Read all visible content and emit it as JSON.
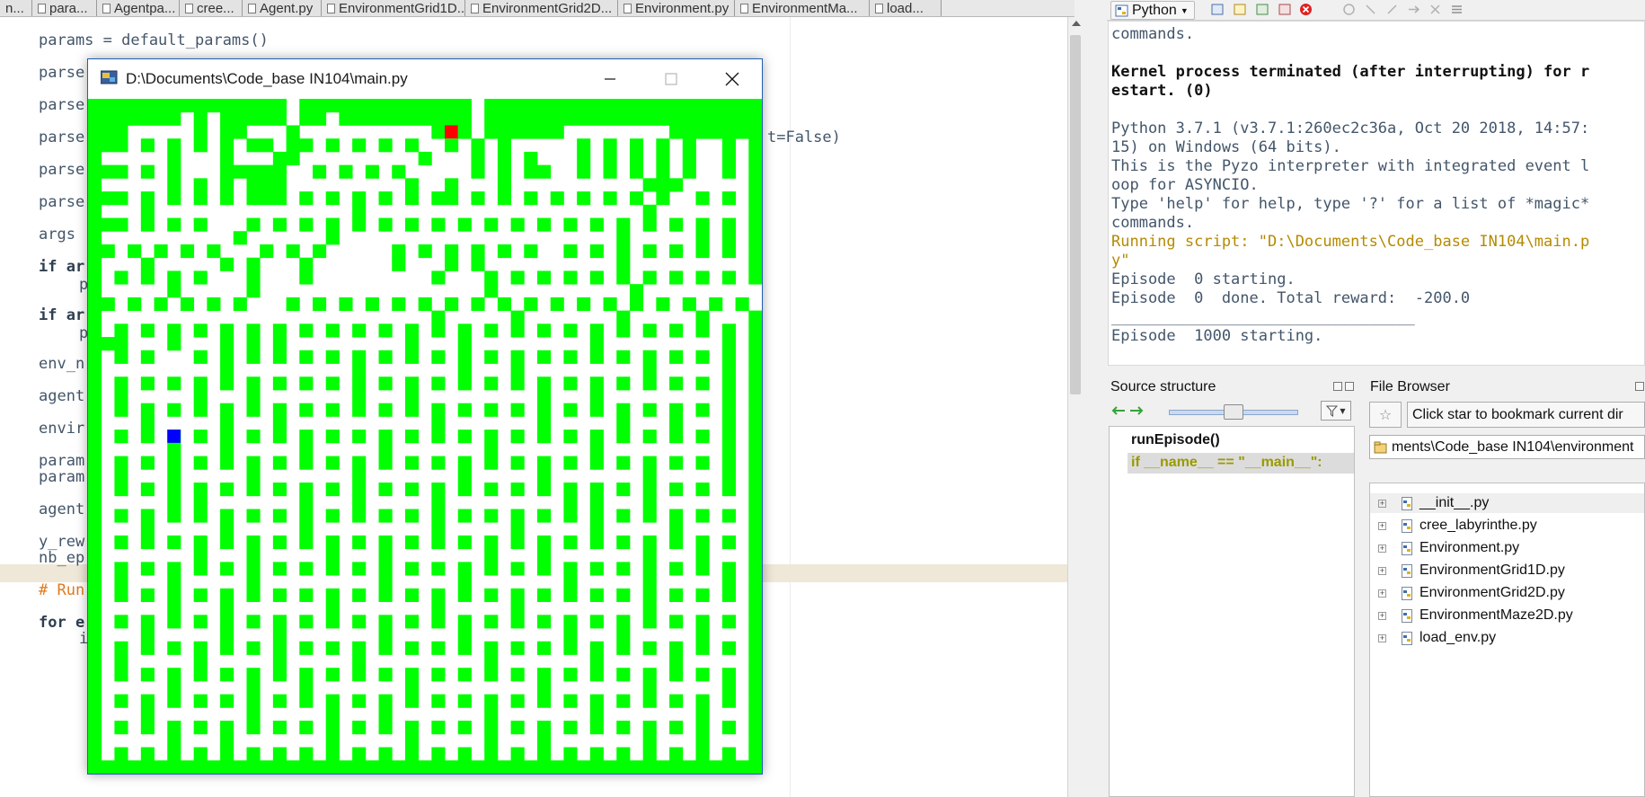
{
  "editor_tabs": [
    {
      "label": "n..."
    },
    {
      "label": "para..."
    },
    {
      "label": "Agentpa..."
    },
    {
      "label": "cree..."
    },
    {
      "label": "Agent.py"
    },
    {
      "label": "EnvironmentGrid1D..."
    },
    {
      "label": "EnvironmentGrid2D..."
    },
    {
      "label": "Environment.py"
    },
    {
      "label": "EnvironmentMa..."
    },
    {
      "label": "load..."
    }
  ],
  "editor_lines": [
    "params = default_params()",
    "parse",
    "parse",
    "parse",
    "parse",
    "parse",
    "args",
    "if ar",
    "p",
    "if ar",
    "p",
    "env_n",
    "agent",
    "envir",
    "param",
    "param",
    "agent",
    "y_rew",
    "nb_ep",
    "# Run",
    "for e",
    "i",
    "t=False)"
  ],
  "maze_window": {
    "title": "D:\\Documents\\Code_base IN104\\main.py",
    "minimize_label": "Minimize",
    "maximize_label": "Maximize",
    "close_label": "Close"
  },
  "maze": {
    "colors": {
      "wall": "#00ff00",
      "path": "#ffffff",
      "goal": "#ff0000",
      "agent": "#0000ff"
    },
    "goal_cell": [
      2,
      27
    ],
    "agent_cell": [
      25,
      6
    ],
    "rows": [
      "WWWWWWWWWWWWWWW.WWWWWWWWWWWWW.WWWWWWWWWWWWWWWWWWWWW",
      "WWWWWWW.W.WWWWW.WW.WWWWWWWWWW.WWWWWWWWWWWWWWWWWWWWW",
      "WWW.....W.WW...W.........GW.W.WWWWWW........WWWWWWW",
      "WWW.W.W.W.W.WW.WW.W.W.W.W..W.W.W.....W.W.W.W.W..W.W",
      "W.....W...W...WW.........W...W.W.W...W.W.W.W.W..W.W",
      "WWW.W.W...WWWWW..W.W.W.W.....W.W.WW..W.W.W.W.W..W.W",
      "W.....W.W.W.WWW.........W..W...W..........WWW.....W",
      "WWW.W.W.W.W.WWW.W.W.W.W.W.WW.W.W.W.W.W.W.W.W..W.W.W",
      "W...W...............W.....................W.......W",
      "WWW.W.W.W...W.W.W.W.W.W.W.W.W.W.W.W.W.W.W.W.W.W.W.W",
      "W..........W......W.....................W.....W.W.W",
      "WW.W.W.W.W...W.W.W.....W.W.W.W.W.W..W.W.W.W.W.W.W.W",
      "W...W.....W.W...W......W...W.W..........W.........W",
      "W.W.W.W.W...W...W.........W...W.W.W.W.W.W.W.W.W.W.W",
      "W.....W.....W.................W..........W.........W",
      "WW.W.W.W.W.W...W.W.W.W.W.W.W.W.W.W.W.W.W.W.W.W.W.W.W",
      "W.........................W.....W.......W.....W...W",
      "W.W.W.W.W.W.W.W.W.W.W.W.W.W.W.W.W.W.W.W.W.W.W.W.W.W",
      "WWW...W...W.W.W.........W...W.........W.........W.W",
      "W.W.W...W.W.W.W.W.W.W.W.W.W.W.W.W.W.W.W.W.W.W.W.W.W",
      "W.........W.........W.......W...W.........W.....W.W",
      "W.W.W.W.W.W.W.W.W.W.W.W.W.W.W.W.W.W.W.W.W.W.W.W.W.W",
      "W.W.....W...W.......W...W.........W...W.........W.W",
      "W.W.W.W.W.W.W.W.W.W.W.W.W.W.W.W.W.W.W.W.W.W.W.W.W.W",
      "W...W.....W...W...........W.......W.....W...W...W.W",
      "W.W.W.W.W.W.W.W.W.W.W.W.W.W.W.W.W.W.W.W.W.W.W.W.W.W",
      "W.....W...W.....W.....W.......W.......W.........W.W",
      "W.W.W.W.W.W.W.W.W.W.W.W.W.W.W.W.W.W.W.W.W.W.W.W.W.W",
      "W.W...W.....W.......W.......W.....W.......W.....W.W",
      "W.W.W.W.W.W.W.W.W.W.W.W.W.W.W.W.W.W.W.W.W.W.W.W.W.W",
      "W.....W.W.......W...W.....W.........W.W...W.......W",
      "W.W.W.W.W.W.W.W.W.W.W.W.W.W.W.W.W.W.W.W.W.W.W.W.W.W",
      "W...W.....W.....W.........W.....W.....W.....W.....W",
      "W.W.W.W.W.W.W.W.W.W.W.W.W.W.W.W.W.W.W.W.W.W.W.W.W.W",
      "W.......W...W.....W...W.......W...W.......W...W...W",
      "W.W.W.W.W.W.W.W.W.W.W.W.W.W.W.W.W.W.W.W.W.W.W.W.W.W",
      "W.W...W.....W.........W.....W.......W.....W.....W.W",
      "W.W.W.W.W.W.W.W.W.W.W.W.W.W.W.W.W.W.W.W.W.W.W.W.W.W",
      "W.....W...W.......W.......W.....W.........W.......W",
      "W.W.W.W.W.W.W.W.W.W.W.W.W.W.W.W.W.W.W.W.W.W.W.W.W.W",
      "W...W.....W...W.......W.....W.......W...W.....W...W",
      "W.W.W.W.W.W.W.W.W.W.W.W.W.W.W.W.W.W.W.W.W.W.W.W.W.W",
      "W.W.....W.....W.....W.........W.......W.....W.....W",
      "W.W.W.W.W.W.W.W.W.W.W.W.W.W.W.W.W.W.W.W.W.W.W.W.W.W",
      "W.....W.....W...W.......W.........W.......W.....W.W",
      "W.W.W.W.W.W.W.W.W.W.W.W.W.W.W.W.W.W.W.W.W.W.W.W.W.W",
      "W...W.......W.....W...W.......W.......W.......W...W",
      "W.W.W.W.W.W.W.W.W.W.W.W.W.W.W.W.W.W.W.W.W.W.W.W.W.W",
      "W.....W...W.......W.....W.....W...W.......W...W...W",
      "W.W.W.W.W.W.W.W.W.W.W.W.W.W.W.W.W.W.W.W.W.W.W.W.W.W",
      "WWWWWWWWWWWWWWWWWWWWWWWWWWWWWWWWWWWWWWWWWWWWWWWWWWW"
    ]
  },
  "shell_toolbar": {
    "kernel_label": "Python"
  },
  "shell_lines": [
    {
      "text": "commands.",
      "style": "std"
    },
    {
      "text": "",
      "style": "std"
    },
    {
      "text": "Kernel process terminated (after interrupting) for r",
      "style": "bold"
    },
    {
      "text": "estart. (0)",
      "style": "bold"
    },
    {
      "text": "",
      "style": "std"
    },
    {
      "text": "Python 3.7.1 (v3.7.1:260ec2c36a, Oct 20 2018, 14:57:",
      "style": "std"
    },
    {
      "text": "15) on Windows (64 bits).",
      "style": "std"
    },
    {
      "text": "This is the Pyzo interpreter with integrated event l",
      "style": "std"
    },
    {
      "text": "oop for ASYNCIO.",
      "style": "std"
    },
    {
      "text": "Type 'help' for help, type '?' for a list of *magic*",
      "style": "std"
    },
    {
      "text": "commands.",
      "style": "std"
    },
    {
      "text": "Running script: \"D:\\Documents\\Code_base IN104\\main.p",
      "style": "script"
    },
    {
      "text": "y\"",
      "style": "script"
    },
    {
      "text": "Episode  0 starting.",
      "style": "std"
    },
    {
      "text": "Episode  0  done. Total reward:  -200.0",
      "style": "std"
    },
    {
      "text": "_________________________________",
      "style": "rule"
    },
    {
      "text": "Episode  1000 starting.",
      "style": "std"
    }
  ],
  "source_structure": {
    "title": "Source structure",
    "items": [
      {
        "label": "runEpisode()",
        "color": "#111111",
        "selected": false
      },
      {
        "label": "if __name__ == \"__main__\":",
        "color": "#9a9a00",
        "selected": true
      }
    ]
  },
  "file_browser": {
    "title": "File Browser",
    "bookmark_hint": "Click star to bookmark current dir",
    "path": "ments\\Code_base IN104\\environment",
    "files": [
      {
        "name": "__init__.py"
      },
      {
        "name": "cree_labyrinthe.py"
      },
      {
        "name": "Environment.py"
      },
      {
        "name": "EnvironmentGrid1D.py"
      },
      {
        "name": "EnvironmentGrid2D.py"
      },
      {
        "name": "EnvironmentMaze2D.py"
      },
      {
        "name": "load_env.py"
      }
    ]
  }
}
